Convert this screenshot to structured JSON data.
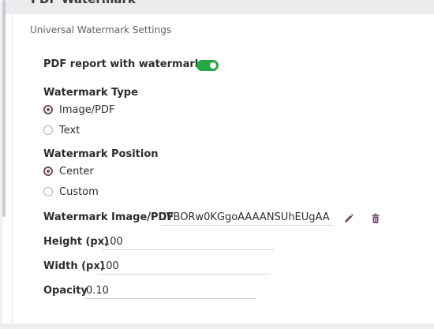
{
  "header": {
    "title": "PDF Watermark"
  },
  "settings": {
    "subtitle": "Universal Watermark Settings",
    "enable_label": "PDF report with watermark",
    "enable_value": true,
    "type": {
      "label": "Watermark Type",
      "options": [
        "Image/PDF",
        "Text"
      ],
      "selected": "Image/PDF"
    },
    "position": {
      "label": "Watermark Position",
      "options": [
        "Center",
        "Custom"
      ],
      "selected": "Center"
    },
    "image": {
      "label": "Watermark Image/PDF",
      "value": "iVBORw0KGgoAAAANSUhEUgAA"
    },
    "height": {
      "label": "Height (px)",
      "value": "100"
    },
    "width": {
      "label": "Width (px)",
      "value": "100"
    },
    "opacity": {
      "label": "Opacity",
      "value": "0.10"
    }
  },
  "colors": {
    "toggle_on": "#28a745",
    "radio_accent": "#714b67",
    "edit_icon": "#714b67",
    "trash_icon": "#714b67"
  },
  "icons": [
    "edit-icon",
    "trash-icon"
  ]
}
